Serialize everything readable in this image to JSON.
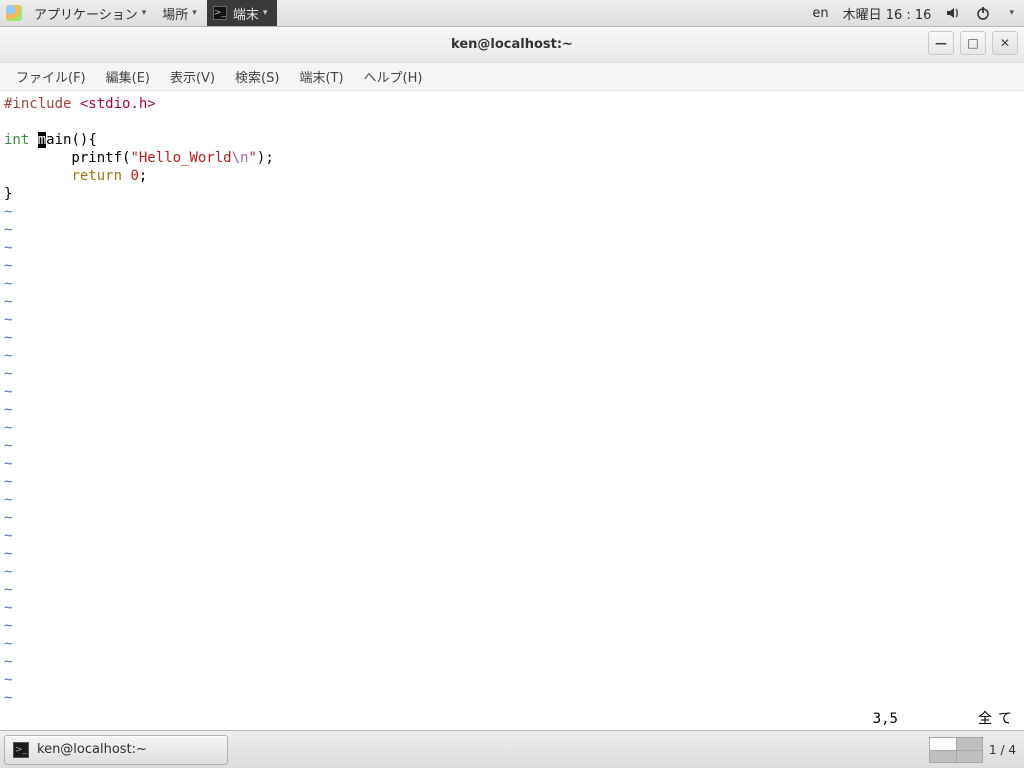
{
  "top_panel": {
    "applications": "アプリケーション",
    "places": "場所",
    "running_app": "端末",
    "lang": "en",
    "clock": "木曜日  16 : 16"
  },
  "window": {
    "title": "ken@localhost:~",
    "menu": {
      "file": "ファイル(F)",
      "edit": "編集(E)",
      "view": "表示(V)",
      "search": "検索(S)",
      "terminal": "端末(T)",
      "help": "ヘルプ(H)"
    }
  },
  "code": {
    "include_kw": "#include",
    "include_hdr": "<stdio.h>",
    "int_kw": "int",
    "m_char": "m",
    "ain_rest": "ain(){",
    "printf_pre": "        printf(",
    "str_open": "\"Hello_World",
    "esc": "\\n",
    "str_close": "\"",
    "printf_post": ");",
    "return_indent": "        ",
    "return_kw": "return",
    "zero": "0",
    "semicolon": ";",
    "close_brace": "}",
    "tilde": "~"
  },
  "vim_status": {
    "pos": "3,5",
    "pct": "全て"
  },
  "taskbar": {
    "task": "ken@localhost:~",
    "workspace": "1 / 4"
  }
}
